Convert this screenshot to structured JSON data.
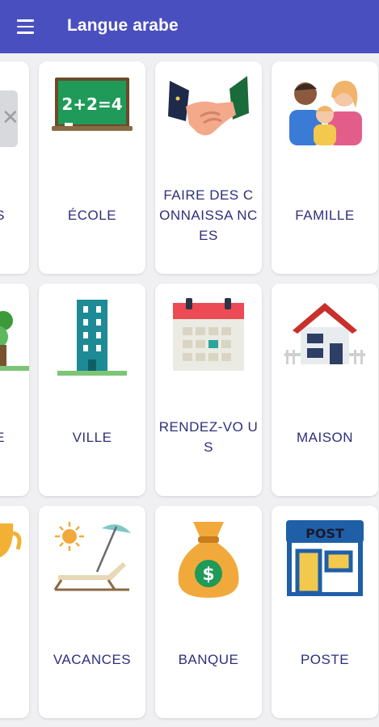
{
  "appbar": {
    "title": "Langue arabe",
    "menu_icon": "hamburger-menu-icon",
    "bg_color": "#4a4fbf"
  },
  "categories": [
    {
      "row": 0,
      "col": 0,
      "label": "ES",
      "icon": "partial-icon",
      "partial": true
    },
    {
      "row": 0,
      "col": 1,
      "label": "ÉCOLE",
      "icon": "chalkboard-icon"
    },
    {
      "row": 0,
      "col": 2,
      "label": "FAIRE DES CONNAISSA NCES",
      "icon": "handshake-icon"
    },
    {
      "row": 0,
      "col": 3,
      "label": "FAMILLE",
      "icon": "family-icon"
    },
    {
      "row": 1,
      "col": 0,
      "label": "RE",
      "icon": "tree-icon",
      "partial": true
    },
    {
      "row": 1,
      "col": 1,
      "label": "VILLE",
      "icon": "building-icon"
    },
    {
      "row": 1,
      "col": 2,
      "label": "RENDEZ-VO US",
      "icon": "calendar-icon"
    },
    {
      "row": 1,
      "col": 3,
      "label": "MAISON",
      "icon": "house-icon"
    },
    {
      "row": 2,
      "col": 0,
      "label": "",
      "icon": "trophy-icon",
      "partial": true
    },
    {
      "row": 2,
      "col": 1,
      "label": "VACANCES",
      "icon": "beach-chair-icon"
    },
    {
      "row": 2,
      "col": 2,
      "label": "BANQUE",
      "icon": "money-bag-icon"
    },
    {
      "row": 2,
      "col": 3,
      "label": "POSTE",
      "icon": "post-office-icon"
    }
  ],
  "icon_texts": {
    "chalkboard": "2+2=4",
    "money_bag": "$",
    "post_office": "POST"
  },
  "colors": {
    "label_text": "#2e2f7a",
    "background": "#f0f0f2",
    "card": "#ffffff"
  }
}
